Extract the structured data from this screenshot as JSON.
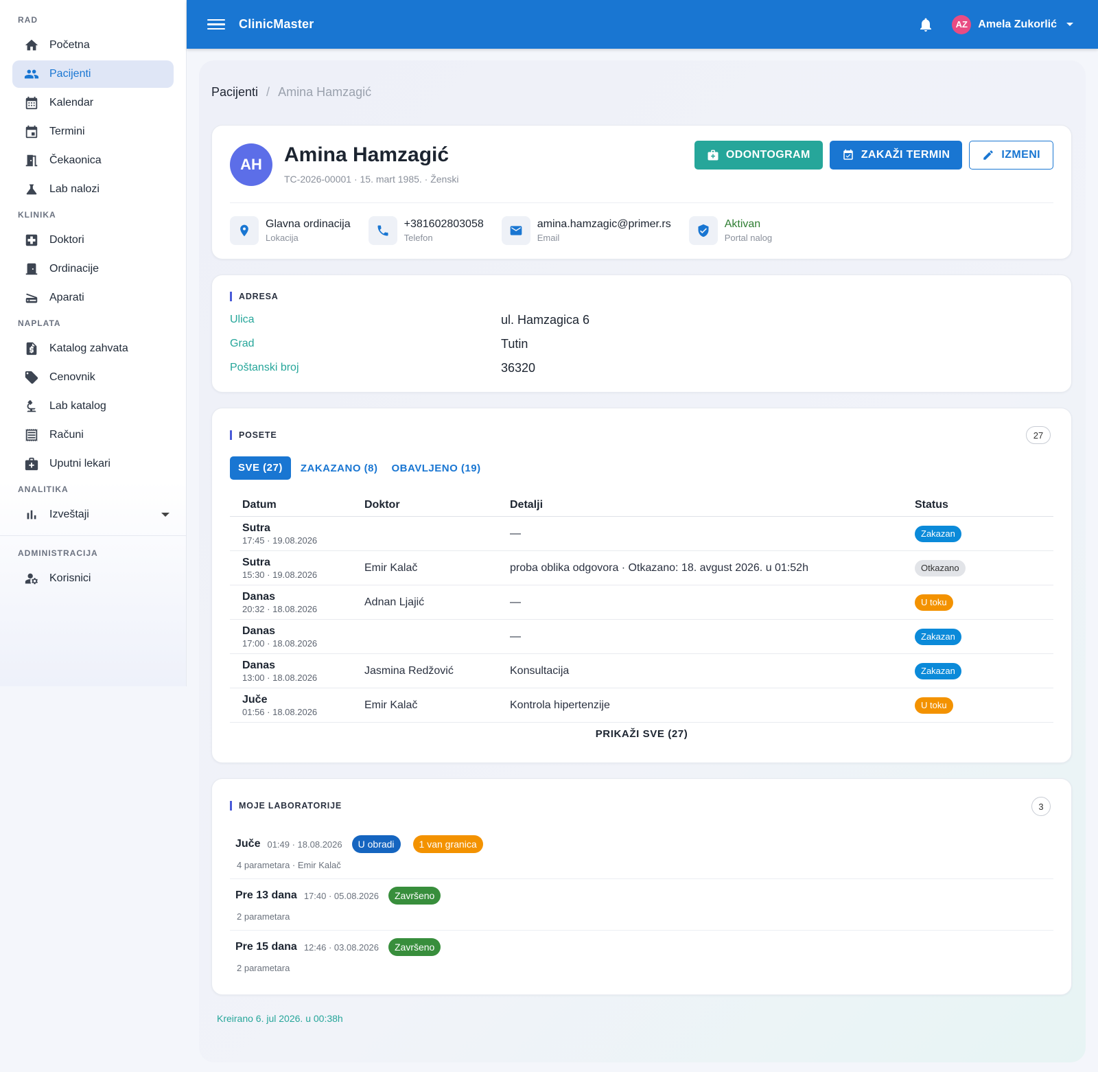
{
  "sidebar": {
    "sections": {
      "rad": "RAD",
      "klinika": "KLINIKA",
      "naplata": "NAPLATA",
      "analitika": "ANALITIKA",
      "administracija": "ADMINISTRACIJA"
    },
    "items": {
      "pocetna": "Početna",
      "pacijenti": "Pacijenti",
      "kalendar": "Kalendar",
      "termini": "Termini",
      "cekaonica": "Čekaonica",
      "lab_nalozi": "Lab nalozi",
      "doktori": "Doktori",
      "ordinacije": "Ordinacije",
      "aparati": "Aparati",
      "katalog_zahvata": "Katalog zahvata",
      "cenovnik": "Cenovnik",
      "lab_katalog": "Lab katalog",
      "racuni": "Računi",
      "uputni_lekari": "Uputni lekari",
      "izvestaji": "Izveštaji",
      "korisnici": "Korisnici"
    },
    "active": "pacijenti"
  },
  "topbar": {
    "app_title": "ClinicMaster",
    "user_initials": "AZ",
    "user_name": "Amela Zukorlić"
  },
  "breadcrumb": {
    "root": "Pacijenti",
    "separator": "/",
    "current": "Amina Hamzagić"
  },
  "patient": {
    "initials": "AH",
    "name": "Amina Hamzagić",
    "meta": "TC-2026-00001 · 15. mart 1985. · Ženski",
    "actions": {
      "odontogram": "ODONTOGRAM",
      "zakazi": "ZAKAŽI TERMIN",
      "izmeni": "IZMENI"
    },
    "info": {
      "location_value": "Glavna ordinacija",
      "location_label": "Lokacija",
      "phone_value": "+381602803058",
      "phone_label": "Telefon",
      "email_value": "amina.hamzagic@primer.rs",
      "email_label": "Email",
      "portal_value": "Aktivan",
      "portal_label": "Portal nalog"
    }
  },
  "address": {
    "title": "ADRESA",
    "rows": [
      {
        "key": "Ulica",
        "value": "ul. Hamzagica 6"
      },
      {
        "key": "Grad",
        "value": "Tutin"
      },
      {
        "key": "Poštanski broj",
        "value": "36320"
      }
    ]
  },
  "visits": {
    "title": "POSETE",
    "count": "27",
    "tabs": [
      "SVE (27)",
      "ZAKAZANO (8)",
      "OBAVLJENO (19)"
    ],
    "columns": [
      "Datum",
      "Doktor",
      "Detalji",
      "Status"
    ],
    "rows": [
      {
        "day": "Sutra",
        "time": "17:45 · 19.08.2026",
        "doctor": "",
        "details": "—",
        "status": "Zakazan",
        "status_color": "#0b8ad9"
      },
      {
        "day": "Sutra",
        "time": "15:30 · 19.08.2026",
        "doctor": "Emir Kalač",
        "details": "proba oblika odgovora · Otkazano: 18. avgust 2026. u 01:52h",
        "status": "Otkazano",
        "status_color": "#e2e4e8"
      },
      {
        "day": "Danas",
        "time": "20:32 · 18.08.2026",
        "doctor": "Adnan Ljajić",
        "details": "—",
        "status": "U toku",
        "status_color": "#f39200"
      },
      {
        "day": "Danas",
        "time": "17:00 · 18.08.2026",
        "doctor": "",
        "details": "—",
        "status": "Zakazan",
        "status_color": "#0b8ad9"
      },
      {
        "day": "Danas",
        "time": "13:00 · 18.08.2026",
        "doctor": "Jasmina Redžović",
        "details": "Konsultacija",
        "status": "Zakazan",
        "status_color": "#0b8ad9"
      },
      {
        "day": "Juče",
        "time": "01:56 · 18.08.2026",
        "doctor": "Emir Kalač",
        "details": "Kontrola hipertenzije",
        "status": "U toku",
        "status_color": "#f39200"
      }
    ],
    "show_all": "PRIKAŽI SVE (27)"
  },
  "labs": {
    "title": "MOJE LABORATORIJE",
    "count": "3",
    "items": [
      {
        "when": "Juče",
        "time": "01:49 · 18.08.2026",
        "badges": [
          "U obradi",
          "1 van granica"
        ],
        "sub": "4 parametara · Emir Kalač"
      },
      {
        "when": "Pre 13 dana",
        "time": "17:40 · 05.08.2026",
        "badges": [
          "Završeno"
        ],
        "sub": "2 parametara"
      },
      {
        "when": "Pre 15 dana",
        "time": "12:46 · 03.08.2026",
        "badges": [
          "Završeno"
        ],
        "sub": "2 parametara"
      }
    ]
  },
  "footer": {
    "created": "Kreirano 6. jul 2026. u 00:38h"
  }
}
